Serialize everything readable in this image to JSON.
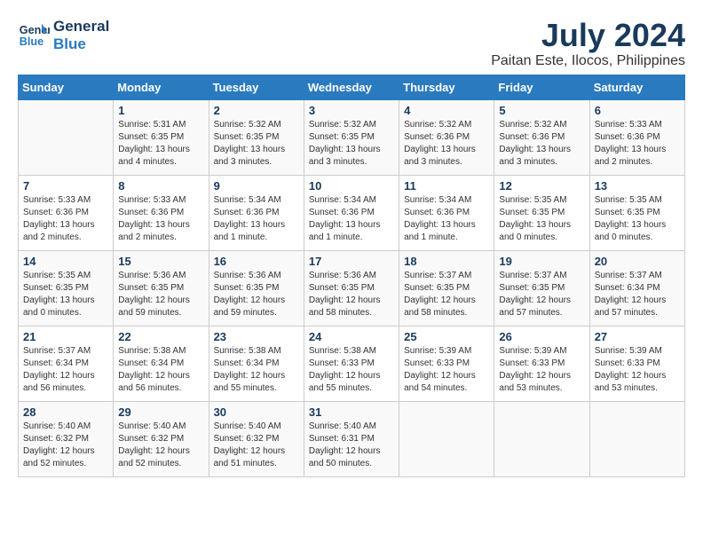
{
  "header": {
    "logo_line1": "General",
    "logo_line2": "Blue",
    "month_year": "July 2024",
    "location": "Paitan Este, Ilocos, Philippines"
  },
  "days_of_week": [
    "Sunday",
    "Monday",
    "Tuesday",
    "Wednesday",
    "Thursday",
    "Friday",
    "Saturday"
  ],
  "weeks": [
    [
      {
        "day": "",
        "info": ""
      },
      {
        "day": "1",
        "info": "Sunrise: 5:31 AM\nSunset: 6:35 PM\nDaylight: 13 hours\nand 4 minutes."
      },
      {
        "day": "2",
        "info": "Sunrise: 5:32 AM\nSunset: 6:35 PM\nDaylight: 13 hours\nand 3 minutes."
      },
      {
        "day": "3",
        "info": "Sunrise: 5:32 AM\nSunset: 6:35 PM\nDaylight: 13 hours\nand 3 minutes."
      },
      {
        "day": "4",
        "info": "Sunrise: 5:32 AM\nSunset: 6:36 PM\nDaylight: 13 hours\nand 3 minutes."
      },
      {
        "day": "5",
        "info": "Sunrise: 5:32 AM\nSunset: 6:36 PM\nDaylight: 13 hours\nand 3 minutes."
      },
      {
        "day": "6",
        "info": "Sunrise: 5:33 AM\nSunset: 6:36 PM\nDaylight: 13 hours\nand 2 minutes."
      }
    ],
    [
      {
        "day": "7",
        "info": "Sunrise: 5:33 AM\nSunset: 6:36 PM\nDaylight: 13 hours\nand 2 minutes."
      },
      {
        "day": "8",
        "info": "Sunrise: 5:33 AM\nSunset: 6:36 PM\nDaylight: 13 hours\nand 2 minutes."
      },
      {
        "day": "9",
        "info": "Sunrise: 5:34 AM\nSunset: 6:36 PM\nDaylight: 13 hours\nand 1 minute."
      },
      {
        "day": "10",
        "info": "Sunrise: 5:34 AM\nSunset: 6:36 PM\nDaylight: 13 hours\nand 1 minute."
      },
      {
        "day": "11",
        "info": "Sunrise: 5:34 AM\nSunset: 6:36 PM\nDaylight: 13 hours\nand 1 minute."
      },
      {
        "day": "12",
        "info": "Sunrise: 5:35 AM\nSunset: 6:35 PM\nDaylight: 13 hours\nand 0 minutes."
      },
      {
        "day": "13",
        "info": "Sunrise: 5:35 AM\nSunset: 6:35 PM\nDaylight: 13 hours\nand 0 minutes."
      }
    ],
    [
      {
        "day": "14",
        "info": "Sunrise: 5:35 AM\nSunset: 6:35 PM\nDaylight: 13 hours\nand 0 minutes."
      },
      {
        "day": "15",
        "info": "Sunrise: 5:36 AM\nSunset: 6:35 PM\nDaylight: 12 hours\nand 59 minutes."
      },
      {
        "day": "16",
        "info": "Sunrise: 5:36 AM\nSunset: 6:35 PM\nDaylight: 12 hours\nand 59 minutes."
      },
      {
        "day": "17",
        "info": "Sunrise: 5:36 AM\nSunset: 6:35 PM\nDaylight: 12 hours\nand 58 minutes."
      },
      {
        "day": "18",
        "info": "Sunrise: 5:37 AM\nSunset: 6:35 PM\nDaylight: 12 hours\nand 58 minutes."
      },
      {
        "day": "19",
        "info": "Sunrise: 5:37 AM\nSunset: 6:35 PM\nDaylight: 12 hours\nand 57 minutes."
      },
      {
        "day": "20",
        "info": "Sunrise: 5:37 AM\nSunset: 6:34 PM\nDaylight: 12 hours\nand 57 minutes."
      }
    ],
    [
      {
        "day": "21",
        "info": "Sunrise: 5:37 AM\nSunset: 6:34 PM\nDaylight: 12 hours\nand 56 minutes."
      },
      {
        "day": "22",
        "info": "Sunrise: 5:38 AM\nSunset: 6:34 PM\nDaylight: 12 hours\nand 56 minutes."
      },
      {
        "day": "23",
        "info": "Sunrise: 5:38 AM\nSunset: 6:34 PM\nDaylight: 12 hours\nand 55 minutes."
      },
      {
        "day": "24",
        "info": "Sunrise: 5:38 AM\nSunset: 6:33 PM\nDaylight: 12 hours\nand 55 minutes."
      },
      {
        "day": "25",
        "info": "Sunrise: 5:39 AM\nSunset: 6:33 PM\nDaylight: 12 hours\nand 54 minutes."
      },
      {
        "day": "26",
        "info": "Sunrise: 5:39 AM\nSunset: 6:33 PM\nDaylight: 12 hours\nand 53 minutes."
      },
      {
        "day": "27",
        "info": "Sunrise: 5:39 AM\nSunset: 6:33 PM\nDaylight: 12 hours\nand 53 minutes."
      }
    ],
    [
      {
        "day": "28",
        "info": "Sunrise: 5:40 AM\nSunset: 6:32 PM\nDaylight: 12 hours\nand 52 minutes."
      },
      {
        "day": "29",
        "info": "Sunrise: 5:40 AM\nSunset: 6:32 PM\nDaylight: 12 hours\nand 52 minutes."
      },
      {
        "day": "30",
        "info": "Sunrise: 5:40 AM\nSunset: 6:32 PM\nDaylight: 12 hours\nand 51 minutes."
      },
      {
        "day": "31",
        "info": "Sunrise: 5:40 AM\nSunset: 6:31 PM\nDaylight: 12 hours\nand 50 minutes."
      },
      {
        "day": "",
        "info": ""
      },
      {
        "day": "",
        "info": ""
      },
      {
        "day": "",
        "info": ""
      }
    ]
  ]
}
